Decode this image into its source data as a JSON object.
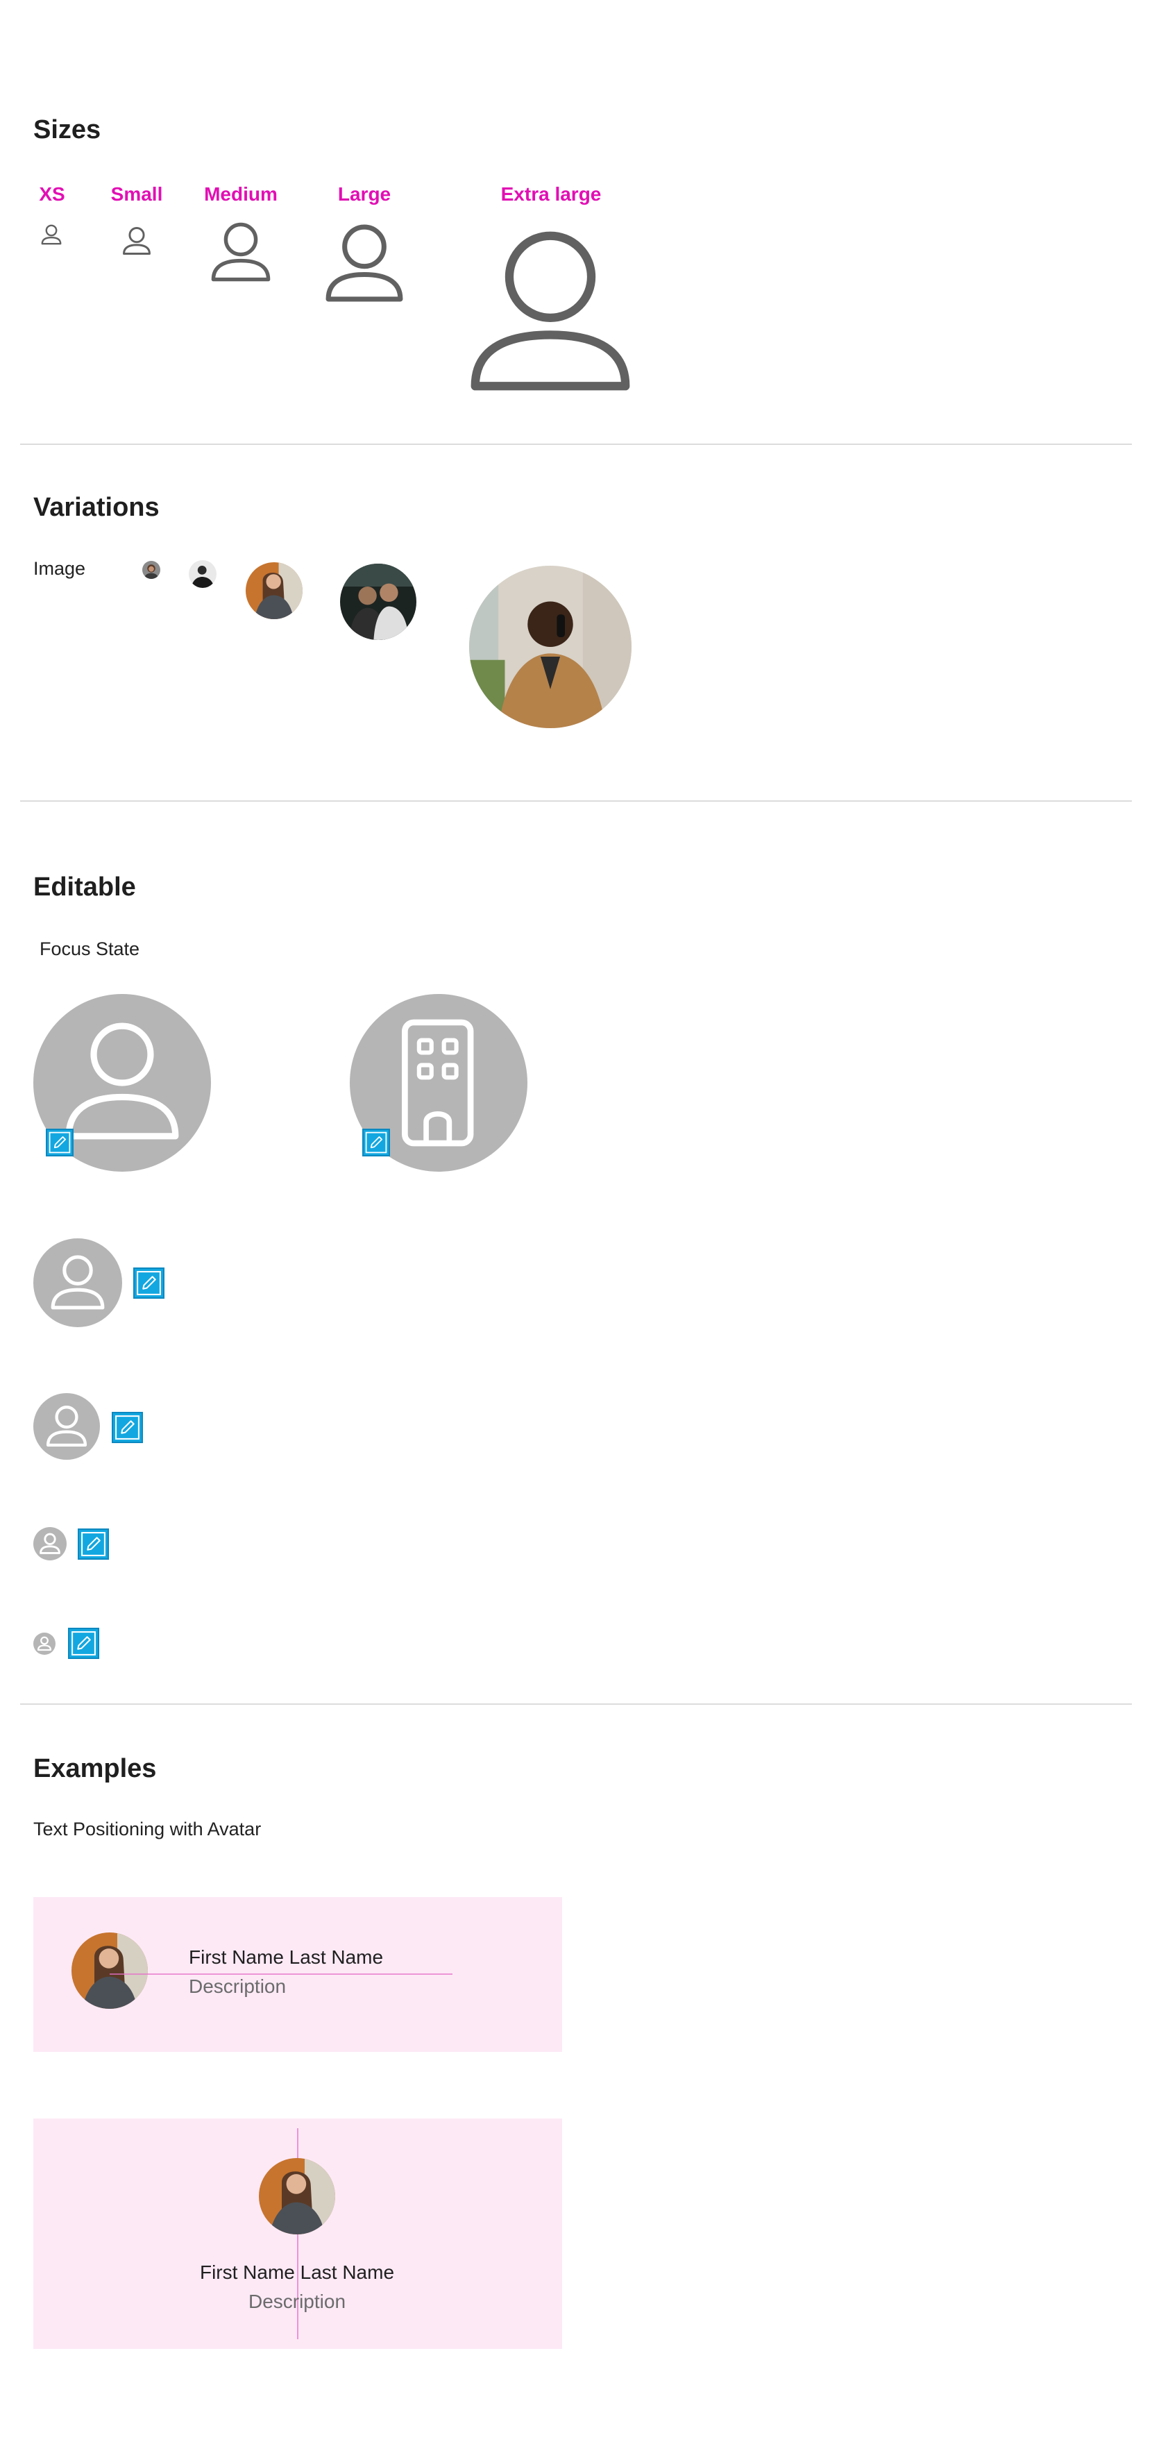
{
  "sections": {
    "sizes": {
      "title": "Sizes",
      "labels": [
        "XS",
        "Small",
        "Medium",
        "Large",
        "Extra large"
      ]
    },
    "variations": {
      "title": "Variations",
      "row_label": "Image"
    },
    "editable": {
      "title": "Editable",
      "subtitle": "Focus State"
    },
    "examples": {
      "title": "Examples",
      "subtitle": "Text Positioning with Avatar",
      "card1": {
        "name": "First Name Last Name",
        "description": "Description"
      },
      "card2": {
        "name": "First Name Last Name",
        "description": "Description"
      }
    }
  },
  "colors": {
    "size_label": "#e20fb4",
    "icon_stroke": "#616161",
    "editable_bg": "#b5b5b5",
    "edit_button": "#12a7e0",
    "card_bg": "#fde9f6",
    "guide_line": "#e66fc9",
    "divider": "#dcdcdc"
  },
  "icons": {
    "person": "person-outline-icon",
    "building": "building-icon",
    "edit": "pencil-icon"
  }
}
